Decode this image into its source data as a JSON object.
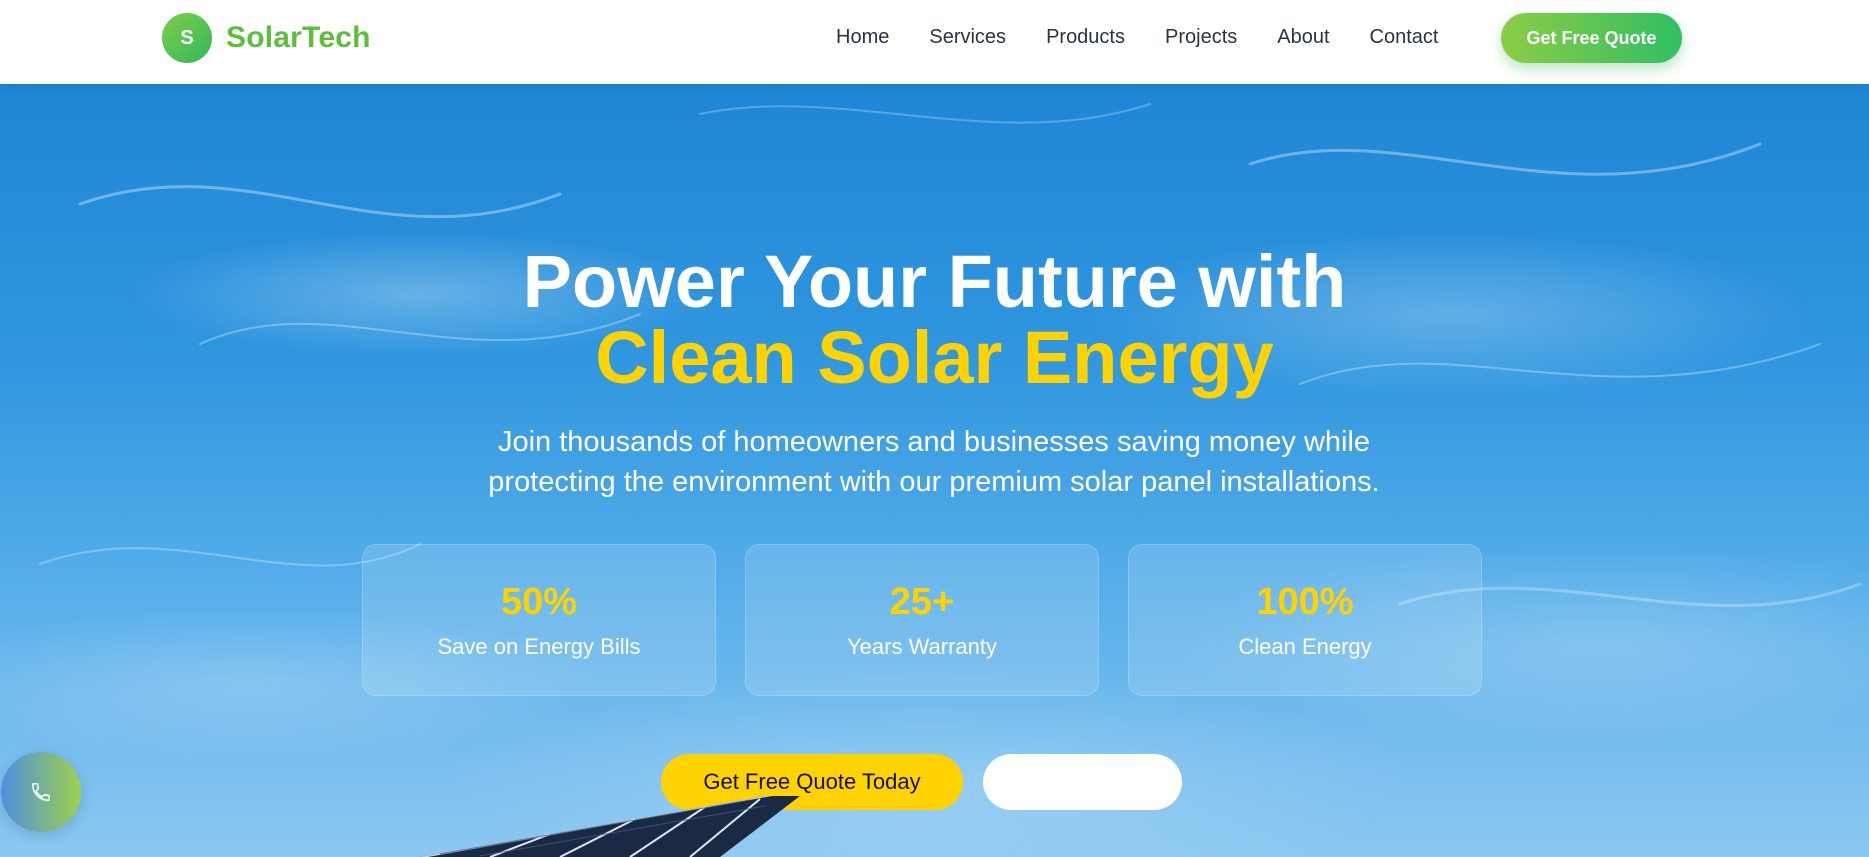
{
  "brand": {
    "badge_letter": "S",
    "name": "SolarTech",
    "color": "#5cbf3c"
  },
  "nav": {
    "items": [
      {
        "label": "Home"
      },
      {
        "label": "Services"
      },
      {
        "label": "Products"
      },
      {
        "label": "Projects"
      },
      {
        "label": "About"
      },
      {
        "label": "Contact"
      }
    ],
    "cta_label": "Get Free Quote"
  },
  "hero": {
    "title_line1": "Power Your Future with",
    "title_line2": "Clean Solar Energy",
    "subtitle_line1": "Join thousands of homeowners and businesses saving money while",
    "subtitle_line2": "protecting the environment with our premium solar panel installations.",
    "stats": [
      {
        "value": "50%",
        "label": "Save on Energy Bills"
      },
      {
        "value": "25+",
        "label": "Years Warranty"
      },
      {
        "value": "100%",
        "label": "Clean Energy"
      }
    ],
    "primary_cta": "Get Free Quote Today",
    "secondary_cta": ""
  },
  "floating": {
    "icon": "phone-icon"
  },
  "colors": {
    "accent_yellow": "#ffd200",
    "accent_green": "#34b65a",
    "sky_blue": "#1f86d6",
    "nav_text": "#2c3440"
  }
}
